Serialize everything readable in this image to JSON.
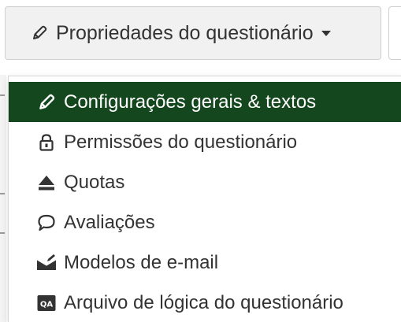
{
  "toolbar": {
    "properties_button": {
      "label": "Propriedades do questionário",
      "icon": "pencil-icon",
      "dropdown_indicator": "caret-down-icon"
    }
  },
  "menu": {
    "items": [
      {
        "label": "Configurações gerais & textos",
        "icon": "pencil-icon",
        "active": true
      },
      {
        "label": "Permissões do questionário",
        "icon": "lock-icon",
        "active": false
      },
      {
        "label": "Quotas",
        "icon": "eject-icon",
        "active": false
      },
      {
        "label": "Avaliações",
        "icon": "speech-bubble-icon",
        "active": false
      },
      {
        "label": "Modelos de e-mail",
        "icon": "envelope-icon",
        "active": false
      },
      {
        "label": "Arquivo de lógica do questionário",
        "icon": "qa-icon",
        "active": false
      }
    ]
  },
  "colors": {
    "active_item_bg": "#14471e",
    "active_item_text": "#ffffff",
    "text": "#333333",
    "button_bg": "#f1f1f1"
  }
}
